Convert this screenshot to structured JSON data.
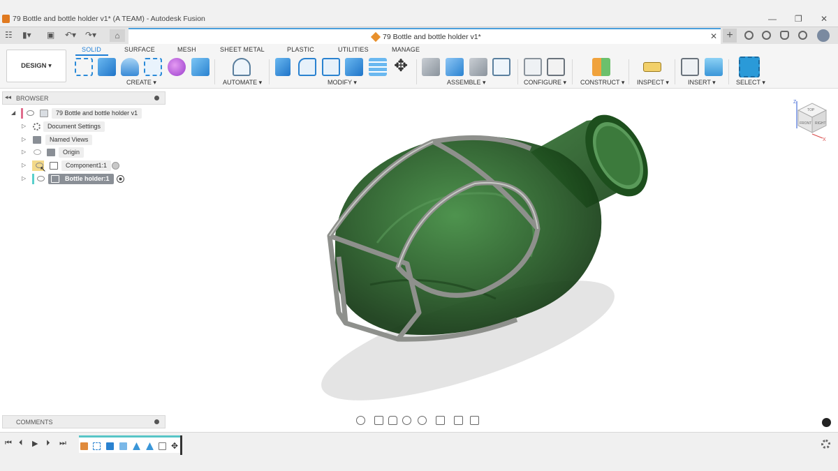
{
  "window": {
    "title": "79 Bottle and bottle holder v1* (A TEAM) - Autodesk Fusion",
    "minimize": "—",
    "restore": "❐",
    "close": "✕"
  },
  "document_tab": {
    "title": "79 Bottle and bottle holder v1*",
    "close": "✕",
    "new_tab": "+"
  },
  "quick_access": {
    "grid": "☷",
    "file": "▮▾",
    "save": "▣",
    "undo": "↶▾",
    "redo": "↷▾",
    "home": "⌂"
  },
  "toolbar": {
    "workspace_button": "DESIGN ▾",
    "tabs": [
      "SOLID",
      "SURFACE",
      "MESH",
      "SHEET METAL",
      "PLASTIC",
      "UTILITIES",
      "MANAGE"
    ],
    "active_tab": "SOLID",
    "groups": [
      "CREATE ▾",
      "AUTOMATE ▾",
      "MODIFY ▾",
      "ASSEMBLE ▾",
      "CONFIGURE ▾",
      "CONSTRUCT ▾",
      "INSPECT ▾",
      "INSERT ▾",
      "SELECT ▾"
    ],
    "accent": "#1f7fd6"
  },
  "browser": {
    "title": "BROWSER",
    "collapse": "◂◂",
    "items": [
      {
        "label": "79 Bottle and bottle holder v1",
        "icon": "document-icon"
      },
      {
        "label": "Document Settings",
        "icon": "gear-icon"
      },
      {
        "label": "Named Views",
        "icon": "folder-icon"
      },
      {
        "label": "Origin",
        "icon": "folder-icon"
      },
      {
        "label": "Component1:1",
        "icon": "component-icon"
      },
      {
        "label": "Bottle holder:1",
        "icon": "component-icon"
      }
    ],
    "expand_open": "◢",
    "expand_closed": "▷"
  },
  "comments": {
    "title": "COMMENTS"
  },
  "timeline": {
    "first": "⏮",
    "prev": "⏴",
    "play": "▶",
    "next": "⏵",
    "last": "⏭"
  },
  "viewcube": {
    "top": "TOP",
    "front": "FRONT",
    "right": "RIGHT",
    "axis_z": "Z",
    "axis_x": "X"
  },
  "colors": {
    "bottle": "#2f6b2f",
    "holder": "#8a8d88",
    "timeline_accent": "#58c5c7"
  }
}
